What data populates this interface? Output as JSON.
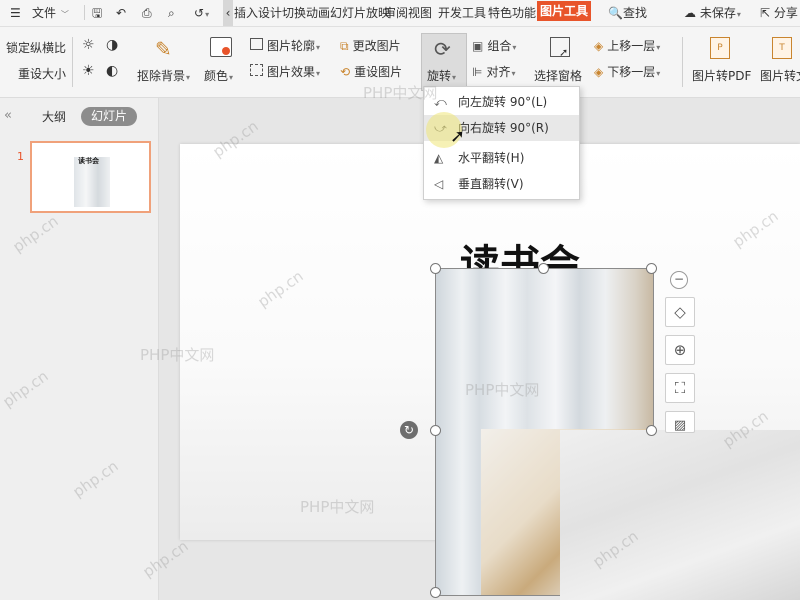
{
  "menubar": {
    "file_label": "文件",
    "tabs": [
      "插入",
      "设计",
      "切换",
      "动画",
      "幻灯片放映",
      "审阅",
      "视图",
      "开发工具",
      "特色功能",
      "图片工具"
    ],
    "search_label": "查找",
    "unsaved_label": "未保存",
    "share_label": "分享"
  },
  "ribbon": {
    "lock_ratio": "锁定纵横比",
    "reset_size": "重设大小",
    "remove_bg": "抠除背景",
    "color": "颜色",
    "outline": "图片轮廓",
    "effects": "图片效果",
    "change_pic": "更改图片",
    "reset_pic": "重设图片",
    "rotate": "旋转",
    "group": "组合",
    "align": "对齐",
    "selection_pane": "选择窗格",
    "bring_forward": "上移一层",
    "send_backward": "下移一层",
    "to_pdf": "图片转PDF",
    "to_text": "图片转文字"
  },
  "rotate_menu": {
    "items": [
      "向左旋转 90°(L)",
      "向右旋转 90°(R)",
      "水平翻转(H)",
      "垂直翻转(V)"
    ]
  },
  "left_panel": {
    "tab_outline": "大纲",
    "tab_slides": "幻灯片",
    "slide_number": "1",
    "thumb_title": "读书会"
  },
  "slide": {
    "title": "读书会"
  },
  "watermarks": [
    "PHP中文网",
    "PHP中文网",
    "PHP中文网",
    "PHP中文网",
    "php.cn",
    "php.cn",
    "php.cn",
    "php.cn",
    "php.cn",
    "php.cn",
    "php.cn",
    "php.cn",
    "php.cn"
  ],
  "colors": {
    "accent": "#e8542a",
    "ribbon_bg": "#f5f5f5"
  }
}
